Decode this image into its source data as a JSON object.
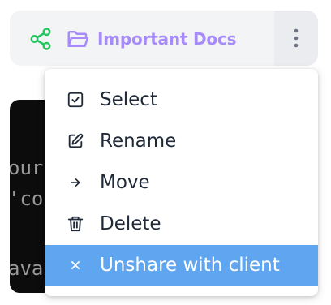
{
  "folder": {
    "title": "Important Docs",
    "share_icon": "share-icon",
    "folder_icon": "folder-open-icon",
    "more_icon": "vertical-ellipsis-icon",
    "title_color": "#a78bfa",
    "share_color": "#22c55e"
  },
  "terminal": {
    "lines": [
      "our",
      "'co",
      "ava"
    ]
  },
  "menu": {
    "items": [
      {
        "label": "Select",
        "icon": "checkbox-icon"
      },
      {
        "label": "Rename",
        "icon": "edit-icon"
      },
      {
        "label": "Move",
        "icon": "arrow-right-icon"
      },
      {
        "label": "Delete",
        "icon": "trash-icon"
      },
      {
        "label": "Unshare with client",
        "icon": "close-icon",
        "highlighted": true
      }
    ],
    "highlight_color": "#60a5f0"
  }
}
